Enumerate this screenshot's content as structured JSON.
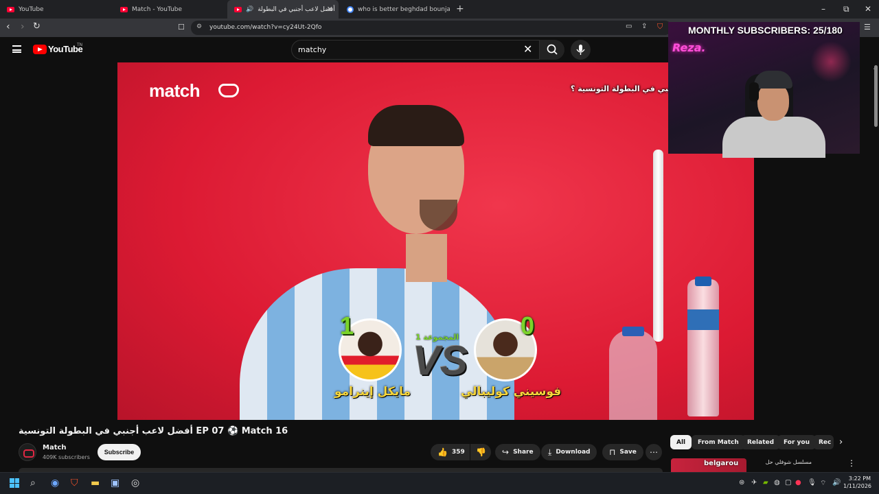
{
  "browser": {
    "tabs": [
      {
        "title": "YouTube",
        "icon": "youtube-icon",
        "active": false
      },
      {
        "title": "Match - YouTube",
        "icon": "youtube-icon",
        "active": false
      },
      {
        "title": "أفضل لاعب أجنبي في البطولة",
        "icon": "youtube-icon",
        "active": true
      },
      {
        "title": "who is better beghdad bounjah or yo",
        "icon": "google-icon",
        "active": false
      }
    ],
    "url": "youtube.com/watch?v=cy24Ut-2Qfo",
    "window_controls": {
      "minimize": "–",
      "restore": "⧉",
      "close": "✕"
    }
  },
  "youtube": {
    "logo_text": "YouTube",
    "logo_region": "TN",
    "search_value": "matchy"
  },
  "video": {
    "brand_logo": "match",
    "caption": "أفضل لاعب أجنبي في البطولة التونسية ؟",
    "graphic": {
      "group_label": "المجموعة 1",
      "vs_text": "VS",
      "left_player": {
        "name": "مايكل إينرامو",
        "score": "1"
      },
      "right_player": {
        "name": "فوسيني كوليبالي",
        "score": "0"
      }
    }
  },
  "webcam": {
    "overlay_text": "MONTHLY SUBSCRIBERS: 25/180",
    "sign_text": "Reza."
  },
  "watch": {
    "title": "أفضل لاعب أجنبي في البطولة التونسية EP 07 ⚽ Match 16",
    "channel_name": "Match",
    "channel_subscribers": "409K subscribers",
    "subscribe_label": "Subscribe",
    "like_count": "359",
    "share_label": "Share",
    "download_label": "Download",
    "save_label": "Save"
  },
  "filters": {
    "chips": [
      "All",
      "From Match",
      "Related",
      "For you",
      "Rec"
    ]
  },
  "recommendation": {
    "thumb_text": "belgarou",
    "title": "مسلسل شوفلي حل"
  },
  "taskbar": {
    "time": "3:22 PM",
    "date": "1/11/2026"
  },
  "colors": {
    "accent_red": "#ff0000",
    "video_bg": "#e8233d",
    "score_green": "#7bd42a",
    "name_yellow": "#f5d53b"
  }
}
